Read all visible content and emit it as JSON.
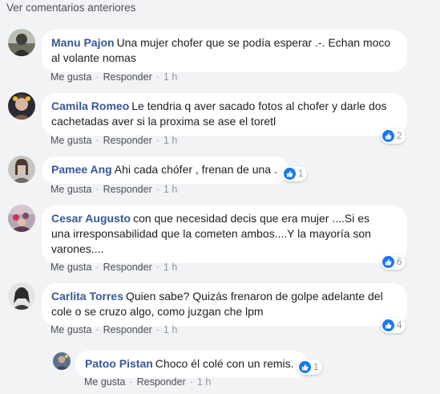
{
  "previous_comments_label": "Ver comentarios anteriores",
  "actions": {
    "like_label": "Me gusta",
    "reply_label": "Responder",
    "separator": "·"
  },
  "colors": {
    "background": "#f2f3f5",
    "author": "#385898",
    "like_badge": "#1877f2"
  },
  "comments": [
    {
      "author": "Manu Pajon",
      "text_line1": "Una mujer chofer que se podía esperar .-. Echan moco",
      "text_line2": "al volante nomas",
      "time": "1 h"
    },
    {
      "author": "Camila Romeo",
      "text_line1": "Le tendria q aver sacado fotos al chofer y darle dos",
      "text_line2": "cachetadas aver si la proxima se ase el toretl",
      "time": "1 h",
      "likes": "2"
    },
    {
      "author": "Pamee Ang",
      "text_line1": "Ahi cada chófer , frenan de una .",
      "time": "1 h",
      "likes": "1"
    },
    {
      "author": "Cesar Augusto",
      "text_line1": "con que necesidad decis que era mujer ....Si es",
      "text_line2": "una irresponsabilidad que la cometen ambos....Y la mayoría son",
      "text_line3": "varones....",
      "time": "1 h",
      "likes": "6"
    },
    {
      "author": "Carlita Torres",
      "text_line1": "Quien sabe? Quizás frenaron de golpe adelante del",
      "text_line2": "cole o se cruzo algo, como juzgan che lpm",
      "time": "1 h",
      "likes": "4"
    }
  ],
  "reply": {
    "author": "Patoo Pistan",
    "text_line1": "Choco él colé con un remis.",
    "time": "1 h",
    "likes": "1"
  }
}
